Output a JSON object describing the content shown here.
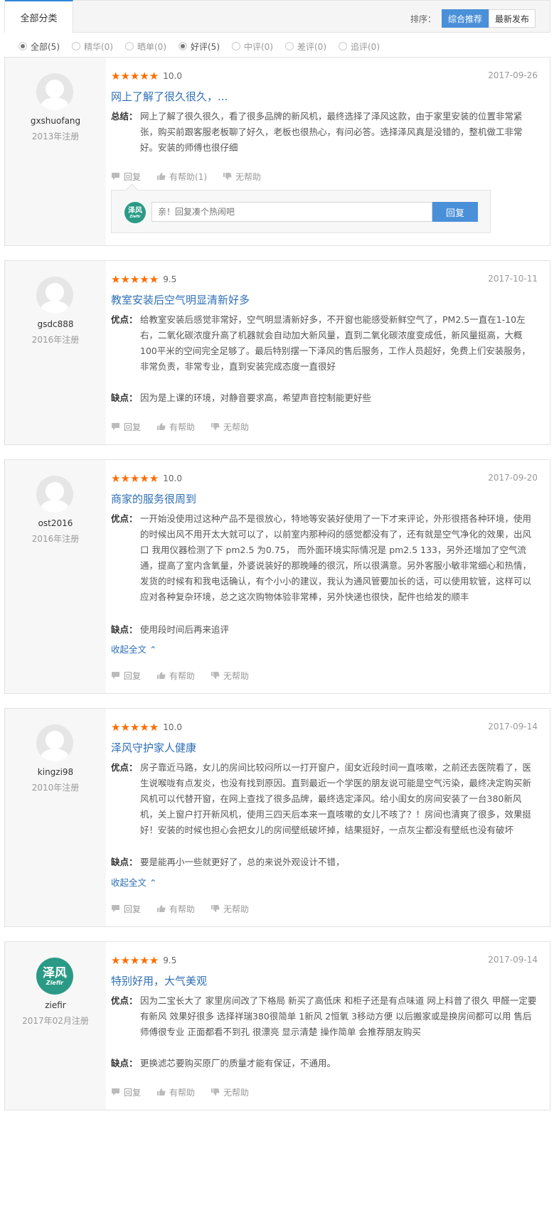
{
  "tabs": {
    "all": "全部分类"
  },
  "sort": {
    "label": "排序：",
    "options": [
      "综合推荐",
      "最新发布"
    ],
    "active": "综合推荐"
  },
  "filters": [
    "全部(5)",
    "精华(0)",
    "晒单(0)",
    "好评(5)",
    "中评(0)",
    "差评(0)",
    "追评(0)"
  ],
  "colors": {
    "accent": "#4a90d9",
    "link": "#2f6fb5",
    "star": "#ff6c00",
    "brand": "#2a9a86"
  },
  "icons": {
    "reply": "speech-bubble-icon",
    "helpful": "thumbs-up-icon",
    "unhelpful": "thumbs-down-icon",
    "collapse": "chevron-up-icon"
  },
  "actions": {
    "reply": "回复",
    "helpful": "有帮助",
    "unhelpful": "无帮助",
    "collapse": "收起全文"
  },
  "labels": {
    "summary": "总结：",
    "pros": "优点：",
    "cons": "缺点："
  },
  "reply_box": {
    "placeholder": "亲！回复凑个热闹吧",
    "button": "回复",
    "brand_cn": "泽风",
    "brand_en": "Ziefir"
  },
  "reviews": [
    {
      "user": "gxshuofang",
      "registered": "2013年注册",
      "stars": "★★★★★",
      "score": "10.0",
      "date": "2017-09-26",
      "title": "网上了解了很久很久，...",
      "summary": "网上了解了很久很久，看了很多品牌的新风机，最终选择了泽风这款，由于家里安装的位置非常紧张，购买前跟客服老板聊了好久，老板也很热心，有问必答。选择泽风真是没错的，整机做工非常好。安装的师傅也很仔细",
      "helpful": "有帮助(1)"
    },
    {
      "user": "gsdc888",
      "registered": "2016年注册",
      "stars": "★★★★★",
      "score": "9.5",
      "date": "2017-10-11",
      "title": "教室安装后空气明显清新好多",
      "pros": "给教室安装后感觉非常好，空气明显清新好多，不开窗也能感受新鲜空气了，PM2.5一直在1-10左右，二氧化碳浓度升高了机器就会自动加大新风量，直到二氧化碳浓度变成低，新风量挺高，大概100平米的空间完全足够了。最后特别摆一下泽风的售后服务，工作人员超好，免费上们安装服务，非常负责，非常专业，直到安装完成态度一直很好",
      "cons": "因为是上课的环境，对静音要求高，希望声音控制能更好些"
    },
    {
      "user": "ost2016",
      "registered": "2016年注册",
      "stars": "★★★★★",
      "score": "10.0",
      "date": "2017-09-20",
      "title": "商家的服务很周到",
      "pros": "一开始没使用过这种产品不是很放心，特地等安装好使用了一下才来评论，外形很搭各种环境，使用的时候出风不用开太大就可以了，以前室内那种闷的感觉都没有了，还有就是空气净化的效果，出风口 我用仪器检测了下 pm2.5 为0.75， 而外面环境实际情况是 pm2.5 133，另外还增加了空气流通，提高了室内含氧量，外婆说装好的那晚睡的很沉，所以很满意。另外客服小敏非常细心和热情，发货的时候有和我电话确认，有个小小的建议，我认为通风管要加长的话，可以使用软管，这样可以应对各种复杂环境，总之这次购物体验非常棒，另外快递也很快，配件也给发的顺丰",
      "cons": "使用段时间后再来追评"
    },
    {
      "user": "kingzi98",
      "registered": "2010年注册",
      "stars": "★★★★★",
      "score": "10.0",
      "date": "2017-09-14",
      "title": "泽风守护家人健康",
      "pros": "房子靠近马路，女儿的房间比较闷所以一打开窗户，闺女近段时间一直咳嗽，之前还去医院看了，医生说喉咙有点发炎，也没有找到原因。直到最近一个学医的朋友说可能是空气污染，最终决定购买新风机可以代替开窗，在网上查找了很多品牌，最终选定泽风。给小闺女的房间安装了一台380新风机，关上窗户打开新风机，使用三四天后本来一直咳嗽的女儿不咳了？！房间也清爽了很多，效果挺好！安装的时候也担心会把女儿的房间壁纸破坏掉，结果挺好，一点灰尘都没有壁纸也没有破坏",
      "cons": "要是能再小一些就更好了，总的来说外观设计不错，"
    },
    {
      "user": "ziefir",
      "registered": "2017年02月注册",
      "stars": "★★★★★",
      "score": "9.5",
      "date": "2017-09-14",
      "title": "特别好用，大气美观",
      "pros": "因为二宝长大了 家里房间改了下格局 新买了高低床 和柜子还是有点味道 网上科普了很久 甲醛一定要有新风 效果好很多 选择祥瑞380很简单 1新风 2恒氧 3移动方便 以后搬家或是换房间都可以用 售后师傅很专业 正面都看不到孔 很漂亮 显示清楚 操作简单 会推荐朋友购买",
      "cons": "更换滤芯要购买原厂的质量才能有保证，不通用。"
    }
  ]
}
